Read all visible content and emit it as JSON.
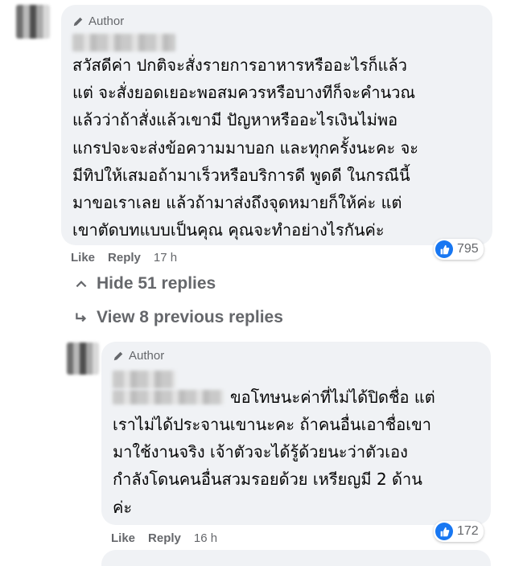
{
  "comment1": {
    "author_badge": "Author",
    "text": "สวัสดีค่า ปกติจะสั่งรายการอาหารหรืออะไรก็แล้ว\nแต่ จะสั่งยอดเยอะพอสมควรหรือบางทีก็จะคำนวณ\nแล้วว่าถ้าสั่งแล้วเขามี ปัญหาหรืออะไรเงินไม่พอ\nแกรปจะจะส่งข้อความมาบอก และทุกครั้งนะคะ จะ\nมีทิปให้เสมอถ้ามาเร็วหรือบริการดี พูดดี ในกรณีนี้\nมาขอเราเลย แล้วถ้ามาส่งถึงจุดหมายก็ให้ค่ะ แต่\nเขาตัดบทแบบเป็นคุณ คุณจะทำอย่างไรกันค่ะ",
    "reaction_count": "795",
    "like_label": "Like",
    "reply_label": "Reply",
    "time": "17 h"
  },
  "thread": {
    "hide_label": "Hide 51 replies",
    "view_label": "View 8 previous replies"
  },
  "comment2": {
    "author_badge": "Author",
    "line1": "ขอโทษนะค่าที่ไม่ได้ปิดชื่อ แต่",
    "text": "เราไม่ได้ประจานเขานะคะ ถ้าคนอื่นเอาชื่อเขา\nมาใช้งานจริง เจ้าตัวจะได้รู้ด้วยนะว่าตัวเอง\nกำลังโดนคนอื่นสวมรอยด้วย เหรียญมี 2 ด้าน\nค่ะ",
    "reaction_count": "172",
    "like_label": "Like",
    "reply_label": "Reply",
    "time": "16 h"
  },
  "colors": {
    "bubble": "#f0f2f5",
    "like_blue": "#1877f2",
    "meta_gray": "#65676b"
  },
  "icons": [
    "pencil-icon",
    "like-reaction-icon",
    "chevron-up-icon",
    "reply-arrow-icon"
  ]
}
